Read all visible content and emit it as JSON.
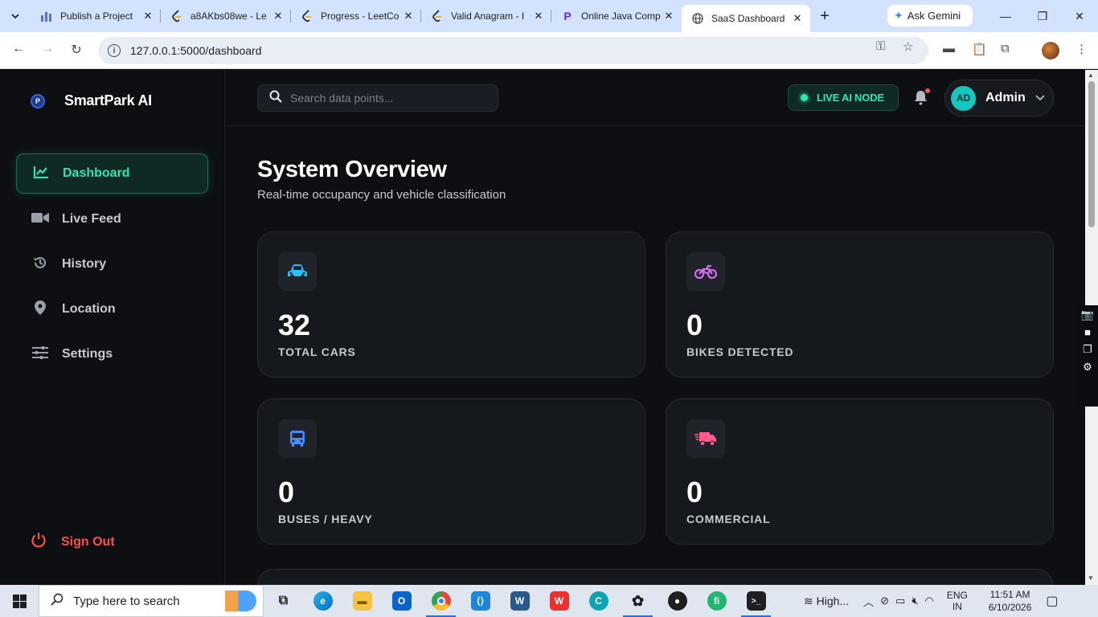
{
  "browser": {
    "tabs": [
      {
        "title": "Publish a Project",
        "icon": "chart-icon",
        "active": false
      },
      {
        "title": "a8AKbs08we - Le",
        "icon": "leetcode-icon",
        "active": false
      },
      {
        "title": "Progress - LeetCo",
        "icon": "leetcode-icon",
        "active": false
      },
      {
        "title": "Valid Anagram - I",
        "icon": "leetcode-icon",
        "active": false
      },
      {
        "title": "Online Java Comp",
        "icon": "p-icon",
        "active": false
      },
      {
        "title": "SaaS Dashboard",
        "icon": "globe-icon",
        "active": true
      }
    ],
    "gemini_label": "Ask Gemini",
    "url": "127.0.0.1:5000/dashboard"
  },
  "sidebar": {
    "brand": "SmartPark AI",
    "items": [
      {
        "label": "Dashboard",
        "icon": "chart-line-icon",
        "active": true
      },
      {
        "label": "Live Feed",
        "icon": "video-camera-icon",
        "active": false
      },
      {
        "label": "History",
        "icon": "history-icon",
        "active": false
      },
      {
        "label": "Location",
        "icon": "map-pin-icon",
        "active": false
      },
      {
        "label": "Settings",
        "icon": "sliders-icon",
        "active": false
      }
    ],
    "signout": "Sign Out"
  },
  "header": {
    "search_placeholder": "Search data points...",
    "live_label": "LIVE AI NODE",
    "user_initials": "AD",
    "user_name": "Admin"
  },
  "main": {
    "title": "System Overview",
    "subtitle": "Real-time occupancy and vehicle classification",
    "cards": [
      {
        "value": "32",
        "label": "TOTAL CARS",
        "icon": "car-icon",
        "color": "#22c3ff"
      },
      {
        "value": "0",
        "label": "BIKES DETECTED",
        "icon": "motorcycle-icon",
        "color": "#d56cf0"
      },
      {
        "value": "0",
        "label": "BUSES / HEAVY",
        "icon": "bus-icon",
        "color": "#4a8cff"
      },
      {
        "value": "0",
        "label": "COMMERCIAL",
        "icon": "truck-icon",
        "color": "#ff5c8a"
      }
    ]
  },
  "taskbar": {
    "search_text": "Type here to search",
    "weather": "High...",
    "lang_top": "ENG",
    "lang_bottom": "IN",
    "time": "11:51 AM",
    "date": "6/10/2026"
  },
  "colors": {
    "accent": "#2ee6b4",
    "danger": "#ff4d4f",
    "background": "#0d0f13",
    "card": "#15181d"
  }
}
